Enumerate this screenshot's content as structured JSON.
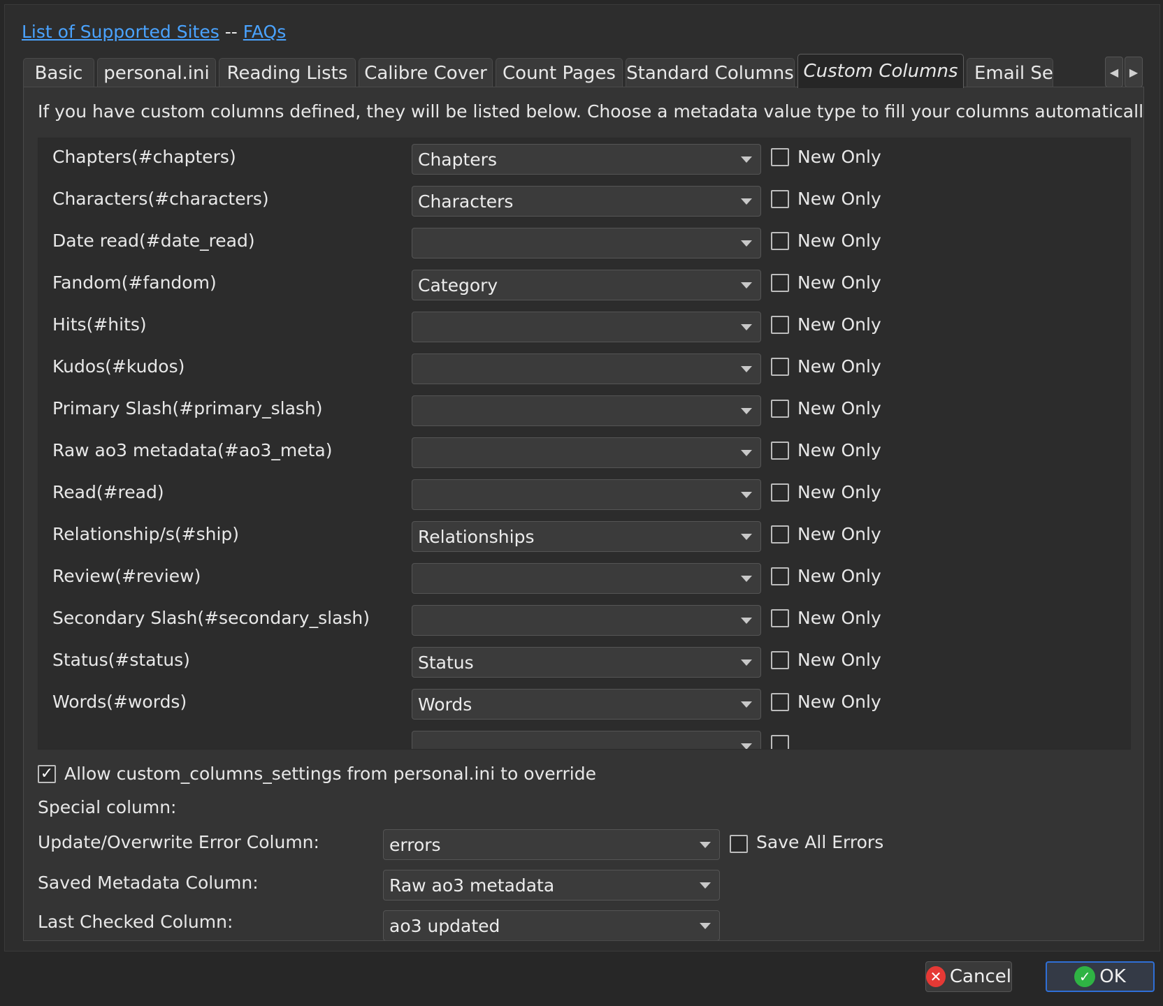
{
  "header": {
    "supported_sites_link": "List of Supported Sites",
    "separator": "--",
    "faqs_link": "FAQs"
  },
  "tabs": [
    {
      "label": "Basic"
    },
    {
      "label": "personal.ini"
    },
    {
      "label": "Reading Lists"
    },
    {
      "label": "Calibre Cover"
    },
    {
      "label": "Count Pages"
    },
    {
      "label": "Standard Columns"
    },
    {
      "label": "Custom Columns",
      "active": true
    },
    {
      "label": "Email Set"
    }
  ],
  "tab_scroll": {
    "left_icon": "triangle-left-icon",
    "right_icon": "triangle-right-icon"
  },
  "intro_text": "If you have custom columns defined, they will be listed below.  Choose a metadata value type to fill your columns automatically.",
  "columns": [
    {
      "name": "Chapters(#chapters)",
      "value": "Chapters",
      "new_only_label": "New Only",
      "new_only": false
    },
    {
      "name": "Characters(#characters)",
      "value": "Characters",
      "new_only_label": "New Only",
      "new_only": false
    },
    {
      "name": "Date read(#date_read)",
      "value": "",
      "new_only_label": "New Only",
      "new_only": false
    },
    {
      "name": "Fandom(#fandom)",
      "value": "Category",
      "new_only_label": "New Only",
      "new_only": false
    },
    {
      "name": "Hits(#hits)",
      "value": "",
      "new_only_label": "New Only",
      "new_only": false
    },
    {
      "name": "Kudos(#kudos)",
      "value": "",
      "new_only_label": "New Only",
      "new_only": false
    },
    {
      "name": "Primary Slash(#primary_slash)",
      "value": "",
      "new_only_label": "New Only",
      "new_only": false
    },
    {
      "name": "Raw ao3 metadata(#ao3_meta)",
      "value": "",
      "new_only_label": "New Only",
      "new_only": false
    },
    {
      "name": "Read(#read)",
      "value": "",
      "new_only_label": "New Only",
      "new_only": false
    },
    {
      "name": "Relationship/s(#ship)",
      "value": "Relationships",
      "new_only_label": "New Only",
      "new_only": false
    },
    {
      "name": "Review(#review)",
      "value": "",
      "new_only_label": "New Only",
      "new_only": false
    },
    {
      "name": "Secondary Slash(#secondary_slash)",
      "value": "",
      "new_only_label": "New Only",
      "new_only": false
    },
    {
      "name": "Status(#status)",
      "value": "Status",
      "new_only_label": "New Only",
      "new_only": false
    },
    {
      "name": "Words(#words)",
      "value": "Words",
      "new_only_label": "New Only",
      "new_only": false
    },
    {
      "name": "",
      "value": "",
      "new_only_label": "",
      "new_only": false
    }
  ],
  "allow_override": {
    "label": "Allow custom_columns_settings from personal.ini to override",
    "checked": true,
    "check_mark": "✓"
  },
  "special": {
    "heading": "Special column:",
    "error_column_label": "Update/Overwrite Error Column:",
    "error_column_value": "errors",
    "save_all_errors_label": "Save All Errors",
    "save_all_errors": false,
    "saved_meta_label": "Saved Metadata Column:",
    "saved_meta_value": "Raw ao3 metadata",
    "last_checked_label": "Last Checked Column:",
    "last_checked_value": "ao3 updated"
  },
  "buttons": {
    "cancel": "Cancel",
    "cancel_icon": "✕",
    "ok": "OK",
    "ok_icon": "✓"
  },
  "colors": {
    "link": "#4aa3ff",
    "ok_border": "#2f6fd6",
    "cancel_icon": "#e53935",
    "ok_icon": "#2fb344"
  }
}
